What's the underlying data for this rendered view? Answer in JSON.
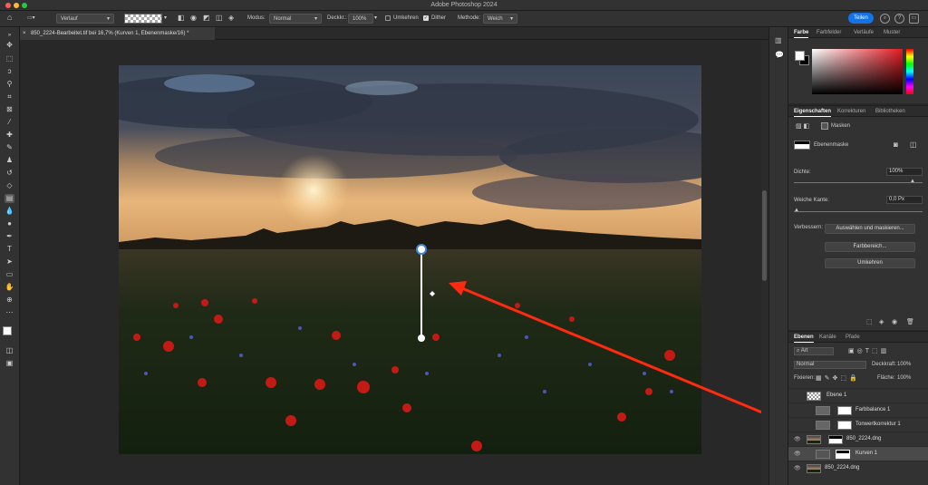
{
  "app": {
    "title": "Adobe Photoshop 2024"
  },
  "options": {
    "tool_preset": "Verlauf",
    "mode_label": "Modus:",
    "mode_value": "Normal",
    "opacity_label": "Deckkr.:",
    "opacity_value": "100%",
    "reverse_label": "Umkehren",
    "dither_label": "Dither",
    "method_label": "Methode:",
    "method_value": "Weich",
    "share_label": "Teilen"
  },
  "document": {
    "tab_title": "850_2224-Bearbeitet.tif bei 16,7% (Kurven 1, Ebenenmaske/16) *"
  },
  "color_panel": {
    "tabs": [
      "Farbe",
      "Farbfelder",
      "Verläufe",
      "Muster"
    ]
  },
  "properties_panel": {
    "tabs": [
      "Eigenschaften",
      "Korrekturen",
      "Bibliotheken"
    ],
    "section_label": "Masken",
    "mask_label": "Ebenenmaske",
    "density_label": "Dichte:",
    "density_value": "100%",
    "feather_label": "Weiche Kante:",
    "feather_value": "0,0 Px",
    "refine_label": "Verbessern:",
    "buttons": [
      "Auswählen und maskieren...",
      "Farbbereich...",
      "Umkehren"
    ]
  },
  "layers_panel": {
    "tabs": [
      "Ebenen",
      "Kanäle",
      "Pfade"
    ],
    "filter_value": "Art",
    "blend_mode": "Normal",
    "opacity_label": "Deckkraft:",
    "opacity_value": "100%",
    "lock_label": "Fixieren:",
    "fill_label": "Fläche:",
    "fill_value": "100%",
    "layers": [
      {
        "name": "Ebene 1"
      },
      {
        "name": "Farbbalance 1"
      },
      {
        "name": "Tonwertkorrektur 1"
      },
      {
        "name": "850_2224.dng"
      },
      {
        "name": "Kurven 1"
      },
      {
        "name": "850_2224.dng"
      }
    ]
  },
  "colors": {
    "accent": "#1473e6",
    "annotation": "#ff2a10",
    "foreground": "#ffffff",
    "background": "#000000"
  }
}
